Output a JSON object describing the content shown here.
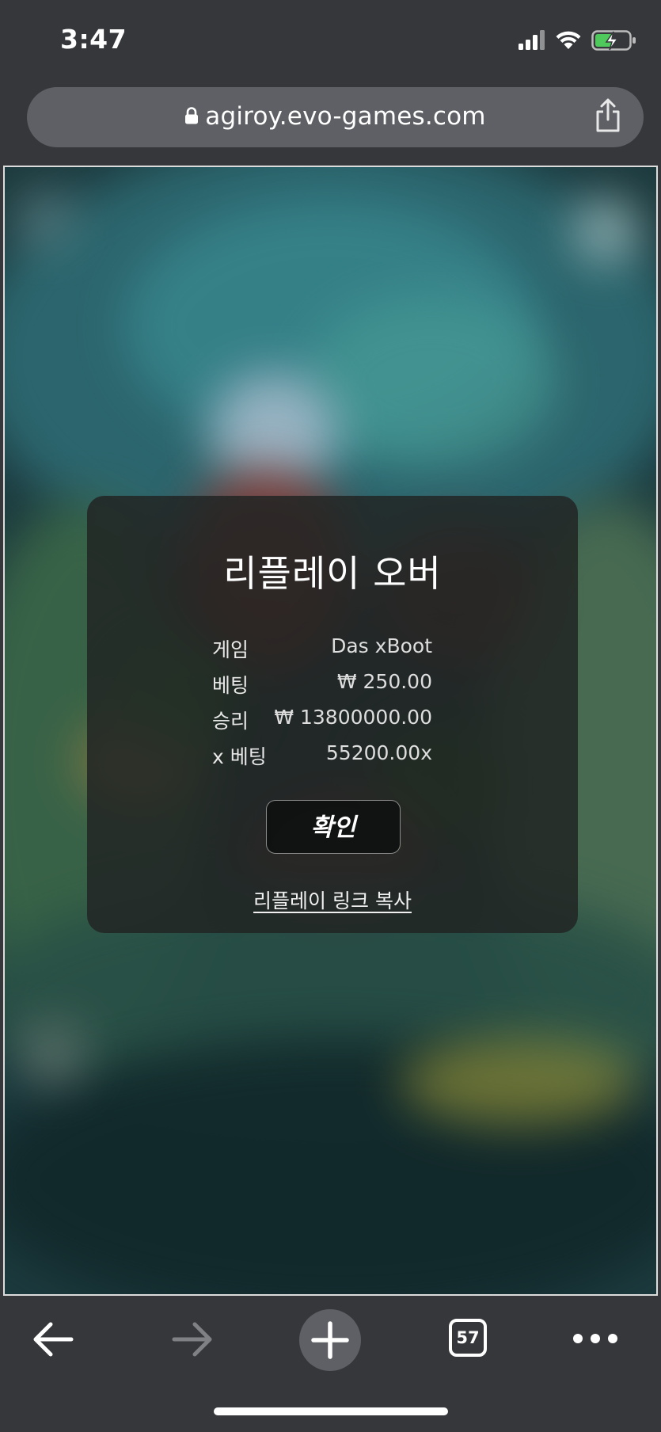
{
  "status_bar": {
    "time": "3:47",
    "icons": [
      "signal-icon",
      "wifi-icon",
      "battery-charging-icon"
    ]
  },
  "browser": {
    "url": "agiroy.evo-games.com",
    "lock_icon": "lock-icon",
    "share_icon": "share-icon"
  },
  "dialog": {
    "title": "리플레이 오버",
    "rows": [
      {
        "label": "게임",
        "value": "Das xBoot"
      },
      {
        "label": "베팅",
        "value": "₩ 250.00"
      },
      {
        "label": "승리",
        "value": "₩ 13800000.00"
      },
      {
        "label": "x 베팅",
        "value": "55200.00x"
      }
    ],
    "confirm_label": "확인",
    "copy_link_label": "리플레이 링크 복사"
  },
  "toolbar": {
    "back_icon": "back-arrow-icon",
    "forward_icon": "forward-arrow-icon",
    "new_tab_icon": "plus-icon",
    "tab_count": "57",
    "more_icon": "more-icon"
  },
  "colors": {
    "chrome_bg": "#36373b",
    "url_bar_bg": "#5e6065",
    "dialog_bg": "#222524",
    "text": "#ffffff"
  }
}
